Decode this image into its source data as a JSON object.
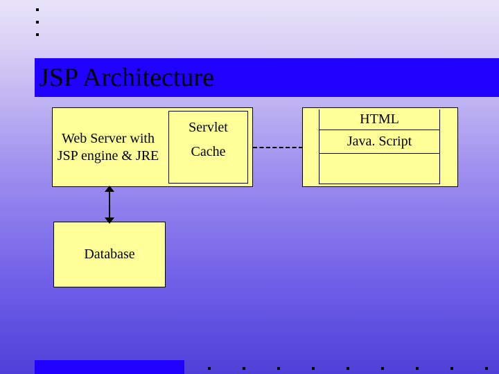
{
  "title": "JSP Architecture",
  "boxes": {
    "webserver": "Web Server with JSP engine & JRE",
    "servlet": "Servlet",
    "cache": "Cache",
    "html": "HTML",
    "javascript": "Java. Script",
    "database": "Database"
  }
}
